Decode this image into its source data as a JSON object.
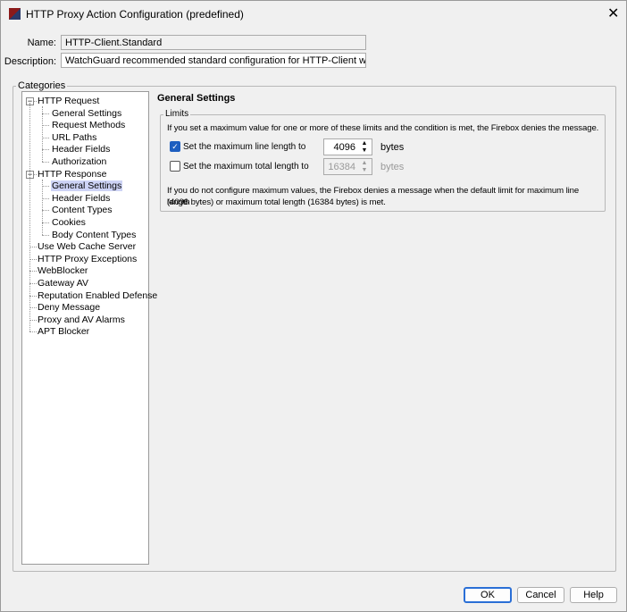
{
  "window": {
    "title": "HTTP Proxy Action Configuration (predefined)",
    "icon": "watchguard-app-icon",
    "close_icon": "close-icon"
  },
  "form": {
    "name_label": "Name:",
    "name_value": "HTTP-Client.Standard",
    "description_label": "Description:",
    "description_value": "WatchGuard recommended standard configuration for HTTP-Client with logging er"
  },
  "categories": {
    "label": "Categories",
    "tree": [
      {
        "label": "HTTP Request",
        "level": 0,
        "expanded": true
      },
      {
        "label": "General Settings",
        "level": 1
      },
      {
        "label": "Request Methods",
        "level": 1
      },
      {
        "label": "URL Paths",
        "level": 1
      },
      {
        "label": "Header Fields",
        "level": 1
      },
      {
        "label": "Authorization",
        "level": 1
      },
      {
        "label": "HTTP Response",
        "level": 0,
        "expanded": true
      },
      {
        "label": "General Settings",
        "level": 1,
        "selected": true
      },
      {
        "label": "Header Fields",
        "level": 1
      },
      {
        "label": "Content Types",
        "level": 1
      },
      {
        "label": "Cookies",
        "level": 1
      },
      {
        "label": "Body Content Types",
        "level": 1
      },
      {
        "label": "Use Web Cache Server",
        "level": 0
      },
      {
        "label": "HTTP Proxy Exceptions",
        "level": 0
      },
      {
        "label": "WebBlocker",
        "level": 0
      },
      {
        "label": "Gateway AV",
        "level": 0
      },
      {
        "label": "Reputation Enabled Defense",
        "level": 0
      },
      {
        "label": "Deny Message",
        "level": 0
      },
      {
        "label": "Proxy and AV Alarms",
        "level": 0
      },
      {
        "label": "APT Blocker",
        "level": 0
      }
    ]
  },
  "panel": {
    "heading": "General Settings",
    "limits": {
      "label": "Limits",
      "intro": "If you set a maximum value for one or more of these limits and the condition is met, the Firebox denies the message.",
      "line": {
        "label": "Set the maximum line length to",
        "checked": true,
        "value": "4096",
        "unit": "bytes"
      },
      "total": {
        "label": "Set the maximum total length to",
        "checked": false,
        "value": "16384",
        "unit": "bytes"
      },
      "note_1": "If you do not configure maximum values, the Firebox denies a message when the default limit for maximum line length",
      "note_2": "(4096 bytes) or maximum total length (16384 bytes) is met."
    }
  },
  "buttons": {
    "ok": "OK",
    "cancel": "Cancel",
    "help": "Help"
  },
  "colors": {
    "accent": "#1e5fc0",
    "selection": "#cdd3f5"
  }
}
